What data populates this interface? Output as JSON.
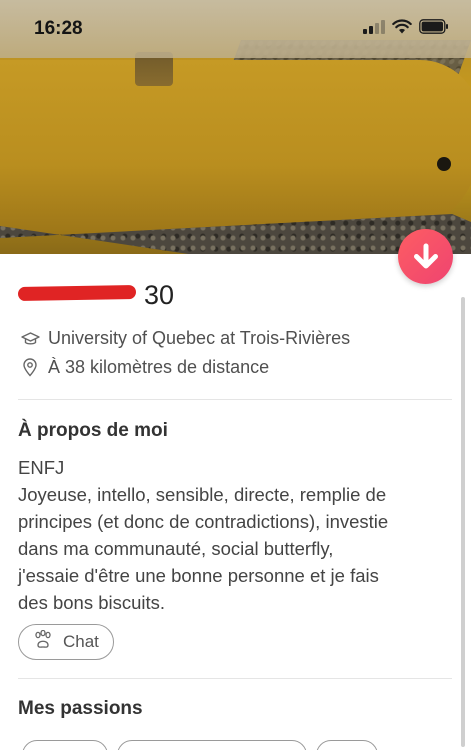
{
  "status_bar": {
    "time": "16:28"
  },
  "profile": {
    "age": "30",
    "school": "University of Quebec at Trois-Rivières",
    "distance": "À 38 kilomètres de distance"
  },
  "about": {
    "title": "À propos de moi",
    "bio": "ENFJ\nJoyeuse, intello, sensible, directe, remplie de\nprincipes (et donc de contradictions), investie\ndans ma communauté, social butterfly,\nj'essaie d'être une bonne personne et je fais\ndes bons biscuits.",
    "chip_label": "Chat"
  },
  "passions": {
    "title": "Mes passions"
  },
  "colors": {
    "accent_gradient_start": "#fd5d63",
    "accent_gradient_end": "#ef4470",
    "redaction": "#e02424"
  },
  "icons": {
    "school": "graduation-cap-icon",
    "distance": "location-pin-icon",
    "chip": "paw-icon",
    "fab": "arrow-down-icon"
  }
}
